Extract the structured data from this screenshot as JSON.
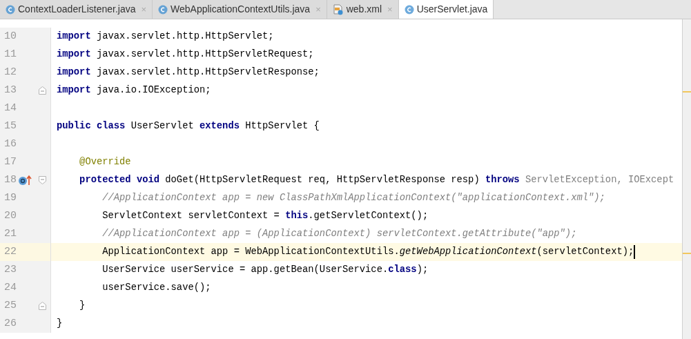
{
  "tabs": [
    {
      "label": "ContextLoaderListener.java",
      "kind": "class",
      "selected": false,
      "closable": true,
      "close": "×"
    },
    {
      "label": "WebApplicationContextUtils.java",
      "kind": "class",
      "selected": false,
      "closable": true,
      "close": "×"
    },
    {
      "label": "web.xml",
      "kind": "xml",
      "selected": false,
      "closable": true,
      "close": "×"
    },
    {
      "label": "UserServlet.java",
      "kind": "class",
      "selected": true,
      "closable": false
    }
  ],
  "editor": {
    "lines": [
      {
        "number": "10",
        "current": false,
        "overrides": false,
        "fold_start": false,
        "fold_end": false,
        "tokens": [
          {
            "kind": "keyword",
            "text": "import"
          },
          {
            "kind": "plain",
            "text": " javax.servlet.http.HttpServlet;"
          }
        ]
      },
      {
        "number": "11",
        "current": false,
        "overrides": false,
        "fold_start": false,
        "fold_end": false,
        "tokens": [
          {
            "kind": "keyword",
            "text": "import"
          },
          {
            "kind": "plain",
            "text": " javax.servlet.http.HttpServletRequest;"
          }
        ]
      },
      {
        "number": "12",
        "current": false,
        "overrides": false,
        "fold_start": false,
        "fold_end": false,
        "tokens": [
          {
            "kind": "keyword",
            "text": "import"
          },
          {
            "kind": "plain",
            "text": " javax.servlet.http.HttpServletResponse;"
          }
        ]
      },
      {
        "number": "13",
        "current": false,
        "overrides": false,
        "fold_start": false,
        "fold_end": true,
        "tokens": [
          {
            "kind": "keyword",
            "text": "import"
          },
          {
            "kind": "plain",
            "text": " java.io.IOException;"
          }
        ]
      },
      {
        "number": "14",
        "current": false,
        "overrides": false,
        "fold_start": false,
        "fold_end": false
      },
      {
        "number": "15",
        "current": false,
        "overrides": false,
        "fold_start": false,
        "fold_end": false,
        "tokens": [
          {
            "kind": "keyword",
            "text": "public class"
          },
          {
            "kind": "plain",
            "text": " UserServlet "
          },
          {
            "kind": "keyword",
            "text": "extends"
          },
          {
            "kind": "plain",
            "text": " HttpServlet {"
          }
        ]
      },
      {
        "number": "16",
        "current": false,
        "overrides": false,
        "fold_start": false,
        "fold_end": false
      },
      {
        "number": "17",
        "current": false,
        "overrides": false,
        "fold_start": false,
        "fold_end": false,
        "tokens": [
          {
            "kind": "annotation",
            "text": "    @Override"
          }
        ]
      },
      {
        "number": "18",
        "current": false,
        "overrides": true,
        "fold_start": true,
        "fold_end": false,
        "tokens": [
          {
            "kind": "keyword",
            "text": "    protected void"
          },
          {
            "kind": "plain",
            "text": " doGet(HttpServletRequest req, HttpServletResponse resp) "
          },
          {
            "kind": "keyword",
            "text": "throws"
          },
          {
            "kind": "muted",
            "text": " ServletException, IOExcept"
          }
        ]
      },
      {
        "number": "19",
        "current": false,
        "overrides": false,
        "fold_start": false,
        "fold_end": false,
        "tokens": [
          {
            "kind": "comment",
            "text": "        //ApplicationContext app = new ClassPathXmlApplicationContext(\"applicationContext.xml\");"
          }
        ]
      },
      {
        "number": "20",
        "current": false,
        "overrides": false,
        "fold_start": false,
        "fold_end": false,
        "tokens": [
          {
            "kind": "plain",
            "text": "        ServletContext servletContext = "
          },
          {
            "kind": "keyword",
            "text": "this"
          },
          {
            "kind": "plain",
            "text": ".getServletContext();"
          }
        ]
      },
      {
        "number": "21",
        "current": false,
        "overrides": false,
        "fold_start": false,
        "fold_end": false,
        "tokens": [
          {
            "kind": "comment",
            "text": "        //ApplicationContext app = (ApplicationContext) servletContext.getAttribute(\"app\");"
          }
        ]
      },
      {
        "number": "22",
        "current": true,
        "overrides": false,
        "fold_start": false,
        "fold_end": false,
        "tokens": [
          {
            "kind": "plain",
            "text": "        ApplicationContext app = WebApplicationContextUtils."
          },
          {
            "kind": "static",
            "text": "getWebApplicationContext"
          },
          {
            "kind": "plain",
            "text": "(servletContext);"
          }
        ]
      },
      {
        "number": "23",
        "current": false,
        "overrides": false,
        "fold_start": false,
        "fold_end": false,
        "tokens": [
          {
            "kind": "plain",
            "text": "        UserService userService = app.getBean(UserService."
          },
          {
            "kind": "keyword",
            "text": "class"
          },
          {
            "kind": "plain",
            "text": ");"
          }
        ]
      },
      {
        "number": "24",
        "current": false,
        "overrides": false,
        "fold_start": false,
        "fold_end": false,
        "tokens": [
          {
            "kind": "plain",
            "text": "        userService.save();"
          }
        ]
      },
      {
        "number": "25",
        "current": false,
        "overrides": false,
        "fold_start": false,
        "fold_end": true,
        "tokens": [
          {
            "kind": "plain",
            "text": "    }"
          }
        ]
      },
      {
        "number": "26",
        "current": false,
        "overrides": false,
        "fold_start": false,
        "fold_end": false,
        "tokens": [
          {
            "kind": "plain",
            "text": "}"
          }
        ]
      }
    ]
  }
}
